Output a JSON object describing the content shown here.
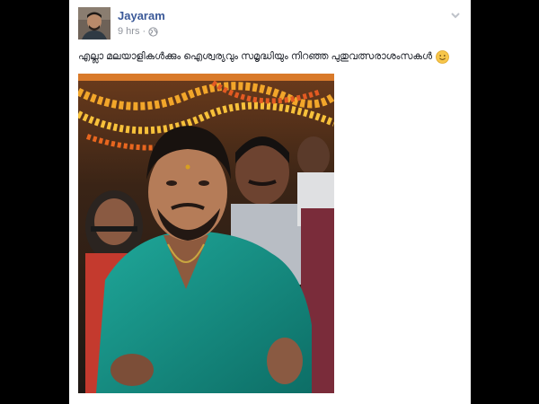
{
  "post": {
    "author": "Jayaram",
    "time": "9 hrs",
    "separator": "·",
    "privacy_icon": "globe-icon",
    "menu_icon": "chevron-down-icon",
    "text": "എല്ലാ മലയാളികൾക്കും ഐശ്വര്യവും സമൃദ്ധിയും നിറഞ്ഞ പുതുവത്സരാശംസകൾ",
    "emoji": "smile-emoji"
  },
  "colors": {
    "page_background": "#000000",
    "card_background": "#ffffff",
    "author_link": "#3b5998",
    "meta_text": "#90949c",
    "body_text": "#1d2129"
  }
}
